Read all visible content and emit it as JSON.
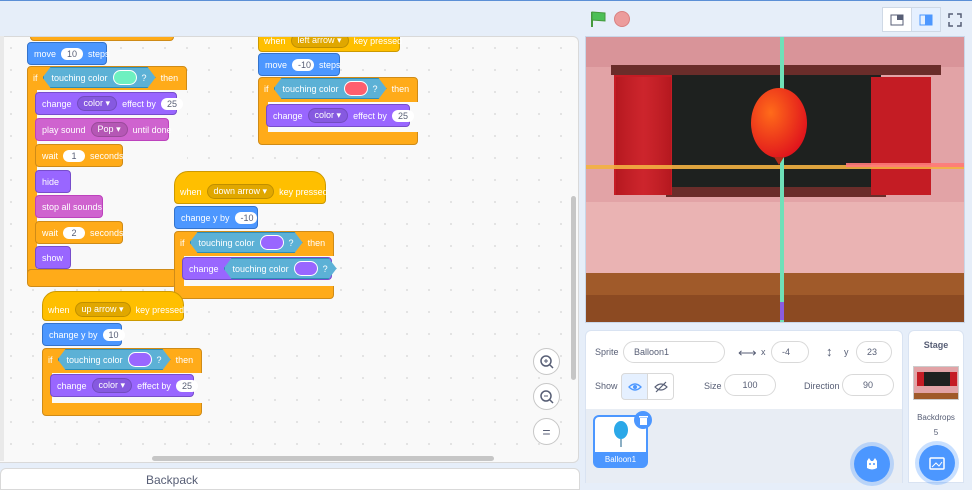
{
  "backpack": {
    "label": "Backpack"
  },
  "scripts": {
    "a": {
      "move": {
        "label": "move",
        "value": "10",
        "unit": "steps"
      },
      "if1": {
        "if": "if",
        "cond": "touching color",
        "q": "?",
        "then": "then",
        "swatch": "#6ef0c0"
      },
      "change1": {
        "label": "change",
        "dd": "color",
        "by": "effect by",
        "value": "25"
      },
      "playsound": {
        "label": "play sound",
        "dd": "Pop",
        "tail": "until done"
      },
      "wait1": {
        "label": "wait",
        "value": "1",
        "unit": "seconds"
      },
      "hide": {
        "label": "hide"
      },
      "stopall": {
        "label": "stop all sounds"
      },
      "wait2": {
        "label": "wait",
        "value": "2",
        "unit": "seconds"
      },
      "show": {
        "label": "show"
      }
    },
    "b": {
      "hat": {
        "when": "when",
        "dd": "left arrow",
        "tail": "key pressed"
      },
      "move": {
        "label": "move",
        "value": "-10",
        "unit": "steps"
      },
      "if1": {
        "if": "if",
        "cond": "touching color",
        "q": "?",
        "then": "then",
        "swatch": "#ff5f6e"
      },
      "change1": {
        "label": "change",
        "dd": "color",
        "by": "effect by",
        "value": "25"
      }
    },
    "c": {
      "hat": {
        "when": "when",
        "dd": "down arrow",
        "tail": "key pressed"
      },
      "changey": {
        "label": "change y by",
        "value": "-10"
      },
      "if1": {
        "if": "if",
        "cond": "touching color",
        "q": "?",
        "then": "then",
        "swatch": "#9966ff"
      },
      "change1": {
        "label": "change",
        "cond": "touching color",
        "q": "?",
        "swatch": "#9966ff"
      }
    },
    "d": {
      "hat": {
        "when": "when",
        "dd": "up arrow",
        "tail": "key pressed"
      },
      "changey": {
        "label": "change y by",
        "value": "10"
      },
      "if1": {
        "if": "if",
        "cond": "touching color",
        "q": "?",
        "then": "then",
        "swatch": "#9966ff"
      },
      "change1": {
        "label": "change",
        "dd": "color",
        "by": "effect by",
        "value": "25"
      }
    }
  },
  "zoom": {
    "in": "+",
    "out": "−",
    "reset": "="
  },
  "sprite": {
    "label": "Sprite",
    "name": "Balloon1",
    "x_label": "x",
    "x": "-4",
    "y_label": "y",
    "y": "23",
    "show_label": "Show",
    "size_label": "Size",
    "size": "100",
    "direction_label": "Direction",
    "direction": "90",
    "thumb_name": "Balloon1"
  },
  "stage_panel": {
    "title": "Stage",
    "backdrops_label": "Backdrops",
    "backdrops_count": "5"
  },
  "colors": {
    "accent": "#4c97ff",
    "flag": "#4cbf56"
  }
}
